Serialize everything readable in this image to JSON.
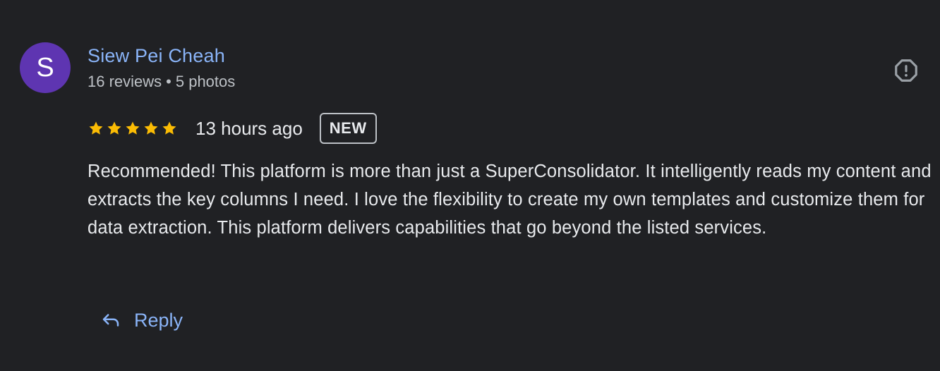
{
  "review": {
    "author": {
      "avatar_letter": "S",
      "avatar_color": "#5e35b1",
      "name": "Siew Pei Cheah",
      "reviews_count": "16 reviews",
      "separator": "•",
      "photos_count": "5 photos"
    },
    "rating": {
      "stars": 5,
      "max_stars": 5,
      "star_color": "#fbbc04"
    },
    "time": "13 hours ago",
    "badge": "NEW",
    "text": "Recommended! This platform is more than just a SuperConsolidator. It intelligently reads my content and extracts the key columns I need. I love the flexibility to create my own templates and customize them for data extraction. This platform delivers capabilities that go beyond the listed services.",
    "flag_icon": "report-flag-icon",
    "reply": {
      "label": "Reply",
      "icon": "reply-arrow-icon"
    }
  },
  "colors": {
    "background": "#202124",
    "link": "#8ab4f8",
    "text_primary": "#e8eaed",
    "text_secondary": "#bdc1c6"
  }
}
